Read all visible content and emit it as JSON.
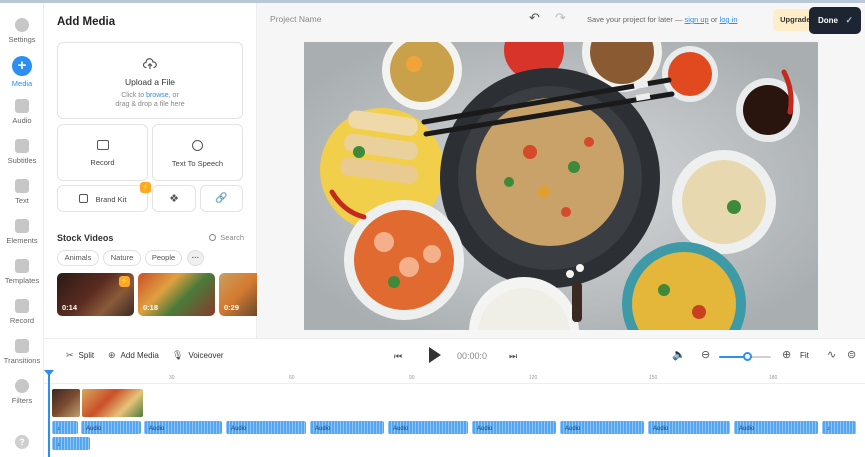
{
  "rail": [
    {
      "label": "Settings",
      "icon": "gear-icon"
    },
    {
      "label": "Media",
      "icon": "plus-icon",
      "active": true
    },
    {
      "label": "Audio",
      "icon": "music-note-icon"
    },
    {
      "label": "Subtitles",
      "icon": "subtitles-icon"
    },
    {
      "label": "Text",
      "icon": "text-icon"
    },
    {
      "label": "Elements",
      "icon": "shapes-icon"
    },
    {
      "label": "Templates",
      "icon": "templates-icon"
    },
    {
      "label": "Record",
      "icon": "record-icon"
    },
    {
      "label": "Transitions",
      "icon": "transitions-icon"
    },
    {
      "label": "Filters",
      "icon": "filters-icon"
    }
  ],
  "panel": {
    "title": "Add Media",
    "upload": {
      "title": "Upload a File",
      "line1_pre": "Click to ",
      "line1_link": "browse",
      "line1_post": ", or",
      "line2": "drag & drop a file here"
    },
    "record_label": "Record",
    "tts_label": "Text To Speech",
    "brand_kit_label": "Brand Kit",
    "stock_title": "Stock Videos",
    "search_label": "Search",
    "chips": [
      "Animals",
      "Nature",
      "People"
    ],
    "chip_more": "···",
    "thumbs": [
      {
        "duration": "0:14",
        "premium": true
      },
      {
        "duration": "0:18",
        "premium": false
      },
      {
        "duration": "0:29",
        "premium": false
      }
    ]
  },
  "header": {
    "project_name": "Project Name",
    "save_pre": "Save your project for later — ",
    "sign_up": "sign up",
    "save_or": " or ",
    "log_in": "log in",
    "upgrade_label": "Upgrade",
    "done_label": "Done"
  },
  "toolbar": {
    "split_label": "Split",
    "add_media_label": "Add Media",
    "voiceover_label": "Voiceover",
    "timecode": "00:00:0",
    "fit_label": "Fit",
    "zoom_level": 0.55
  },
  "timeline": {
    "ticks": [
      "30",
      "60",
      "90",
      "120",
      "150",
      "180"
    ],
    "audio_label": "Audio"
  },
  "colors": {
    "accent": "#2b8ef0",
    "done_bg": "#1d2532",
    "upgrade_bg": "#fdeec7",
    "audio_clip": "#55a6f0"
  }
}
